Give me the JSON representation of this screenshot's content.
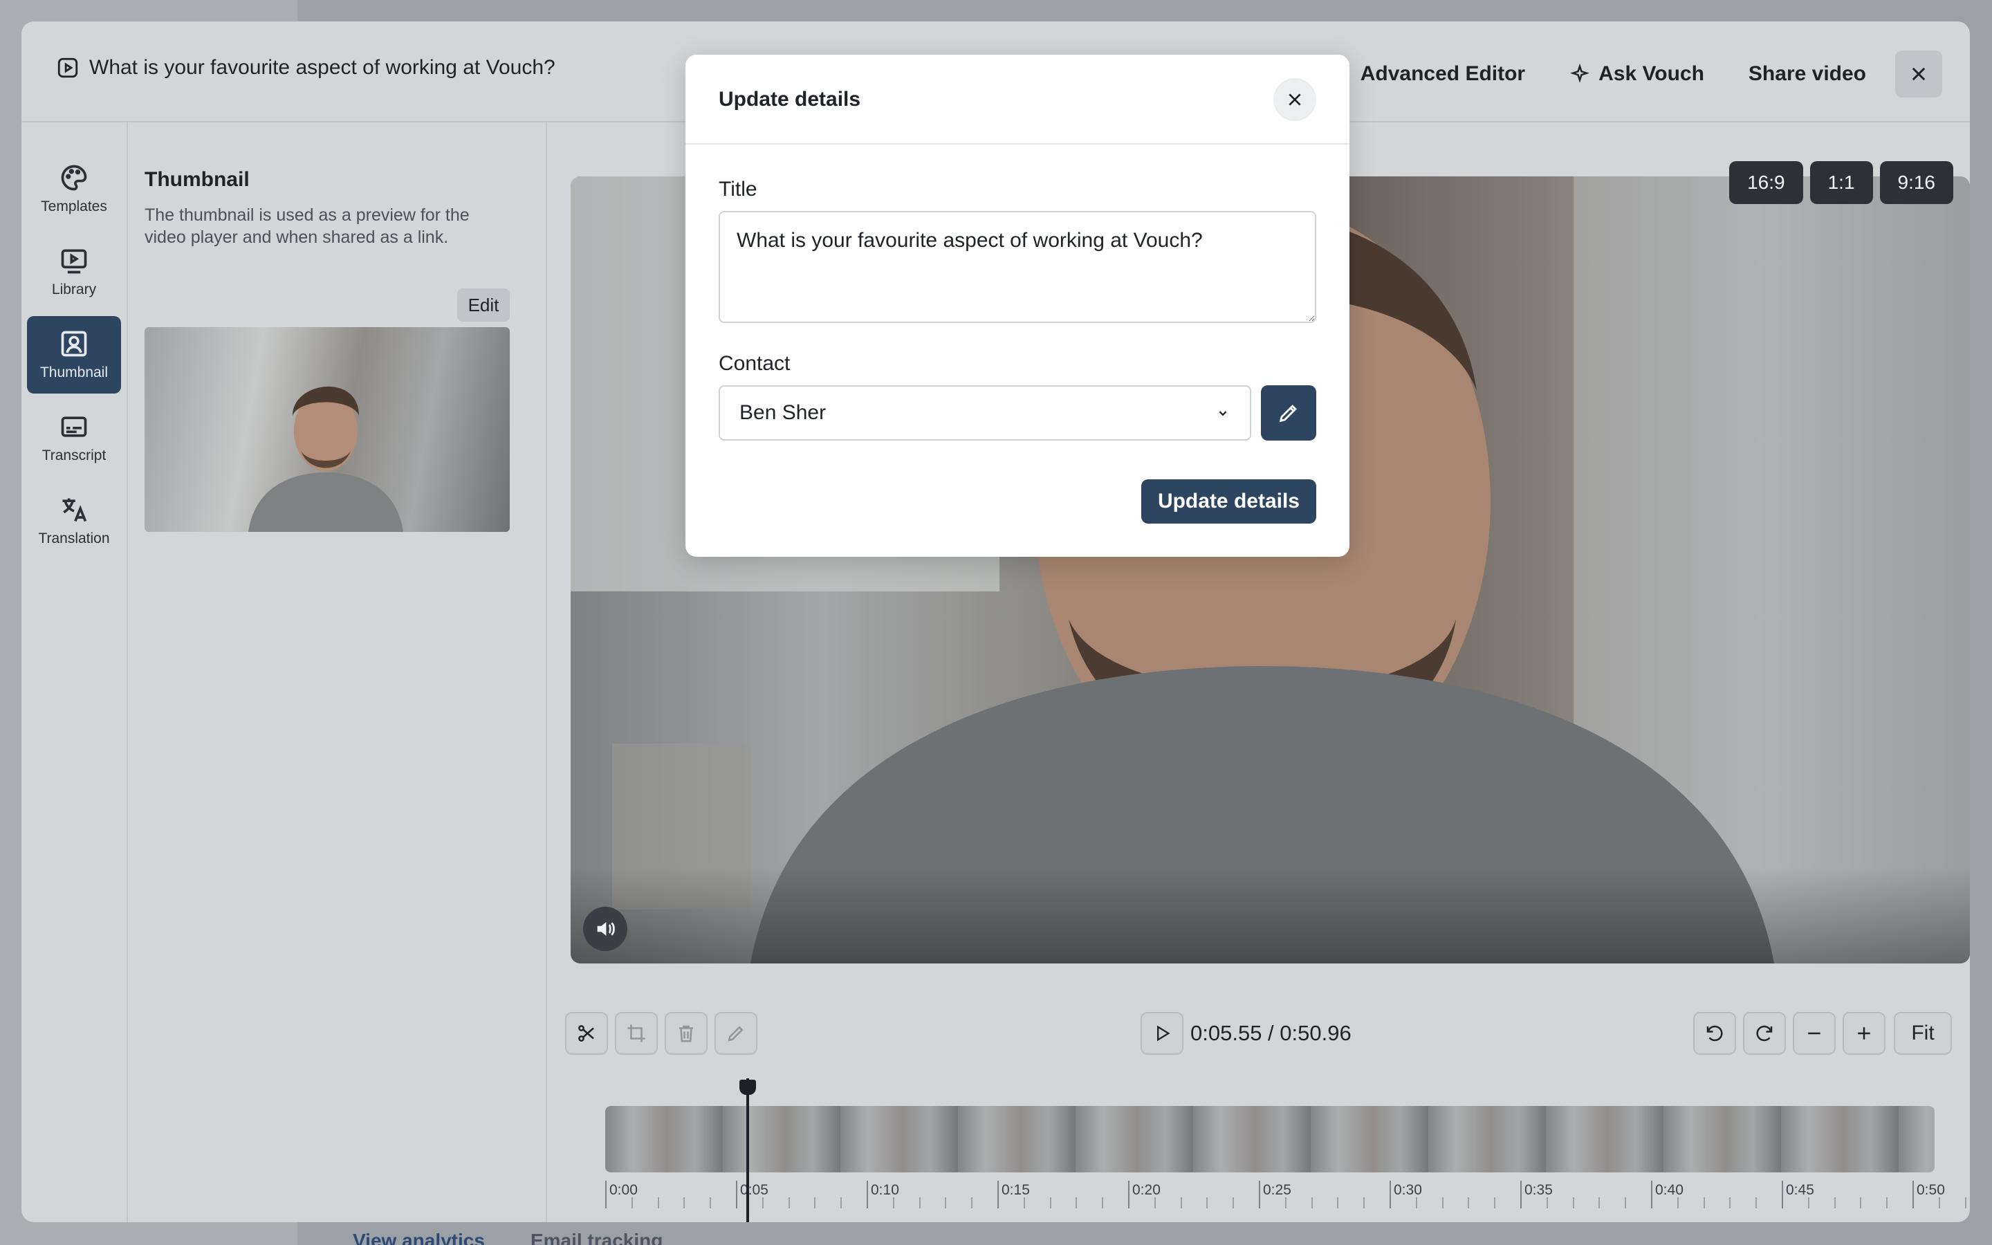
{
  "background": {
    "tabs": [
      "View analytics",
      "Email tracking"
    ]
  },
  "editor": {
    "title": "What is your favourite aspect of working at Vouch?",
    "actions": {
      "advanced_editor": "Advanced Editor",
      "ask_vouch": "Ask Vouch",
      "share_video": "Share video"
    },
    "rail": [
      {
        "label": "Templates",
        "icon": "palette-icon"
      },
      {
        "label": "Library",
        "icon": "play-screen-icon"
      },
      {
        "label": "Thumbnail",
        "icon": "portrait-icon",
        "active": true
      },
      {
        "label": "Transcript",
        "icon": "subtitles-icon"
      },
      {
        "label": "Translation",
        "icon": "translate-icon"
      }
    ],
    "thumbnail_panel": {
      "heading": "Thumbnail",
      "description": "The thumbnail is used as a preview for the video player and when shared as a link.",
      "edit_label": "Edit"
    },
    "aspect_ratios": [
      "16:9",
      "1:1",
      "9:16"
    ],
    "player": {
      "time": "0:05.55 / 0:50.96",
      "fit_label": "Fit"
    },
    "timeline": {
      "ticks": [
        "0:00",
        "0:05",
        "0:10",
        "0:15",
        "0:20",
        "0:25",
        "0:30",
        "0:35",
        "0:40",
        "0:45",
        "0:50"
      ]
    }
  },
  "modal": {
    "title": "Update details",
    "title_label": "Title",
    "title_value": "What is your favourite aspect of working at Vouch?",
    "contact_label": "Contact",
    "contact_value": "Ben Sher",
    "submit_label": "Update details"
  },
  "colors": {
    "accent": "#2e4561",
    "dim_background": "#d3d6d9"
  }
}
